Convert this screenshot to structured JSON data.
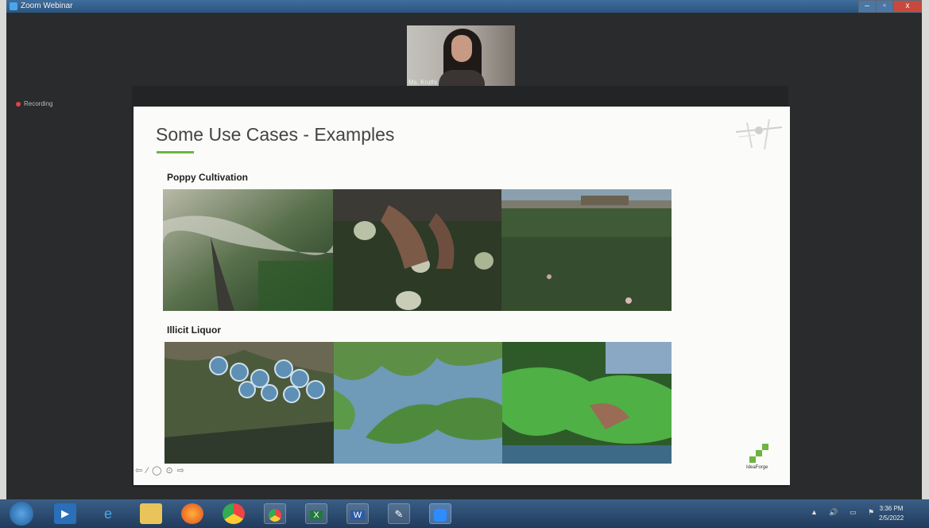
{
  "window": {
    "title": "Zoom Webinar",
    "controls": {
      "minimize": "–",
      "maximize": "▫",
      "close": "x"
    }
  },
  "status": {
    "recording_label": "Recording"
  },
  "video": {
    "participant_name": "Ms. Kruthi"
  },
  "slide": {
    "title": "Some Use Cases - Examples",
    "sections": [
      {
        "label": "Poppy Cultivation"
      },
      {
        "label": "Illicit Liquor"
      }
    ],
    "nav_controls": "⇦ ⁄ ◯ ⊙ ⇨",
    "logo_text": "IdeaForge"
  },
  "taskbar": {
    "apps": [
      "windows-media-player",
      "internet-explorer",
      "file-explorer",
      "firefox",
      "chrome",
      "chrome-profile",
      "excel",
      "word",
      "paint",
      "zoom"
    ],
    "tray_icons": "▲ 🔊 ▭ ⚑",
    "time": "3:36 PM",
    "date": "2/5/2022"
  },
  "colors": {
    "accent_green": "#6fb43f",
    "titlebar": "#2c557f",
    "close": "#c9483d"
  }
}
